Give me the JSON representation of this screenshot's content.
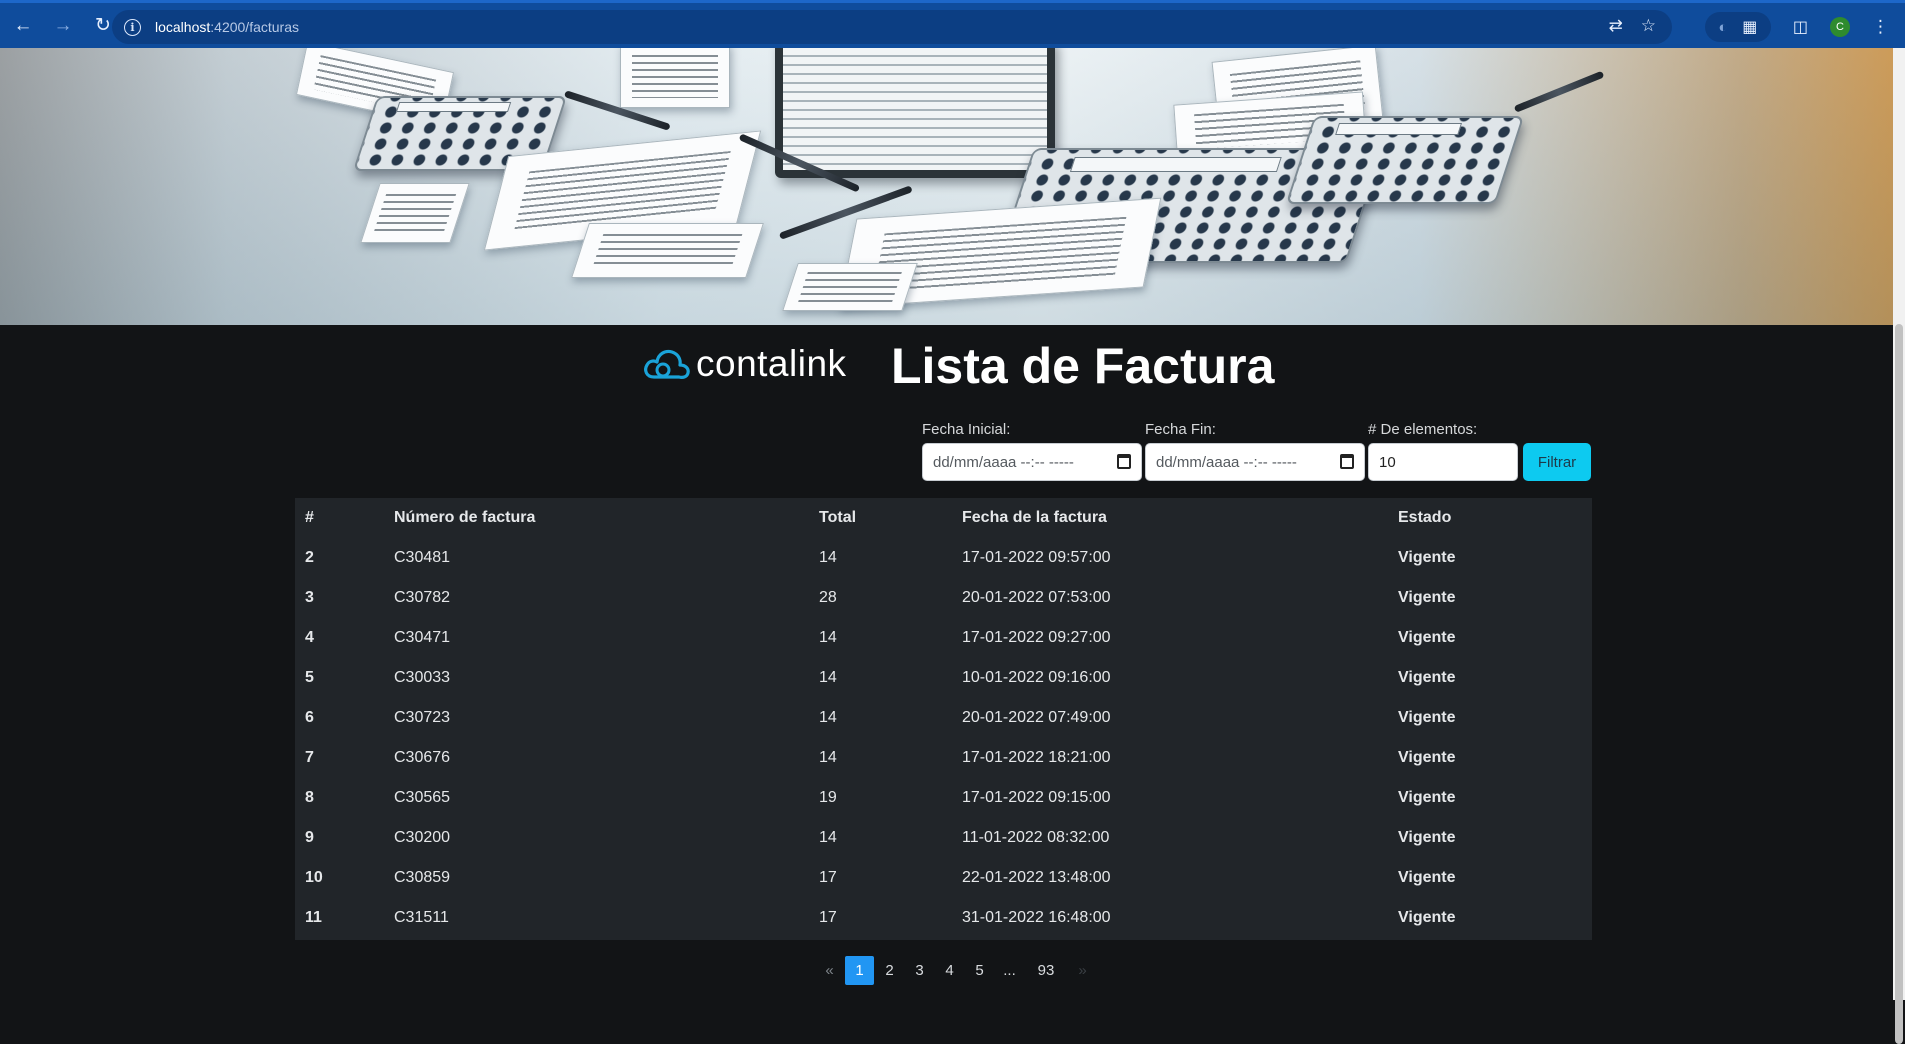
{
  "browser": {
    "url_host": "localhost",
    "url_path": ":4200/facturas",
    "avatar_letter": "C"
  },
  "brand": {
    "logo_text": "contalink",
    "accent": "#1aa3d9"
  },
  "page": {
    "title": "Lista de Factura"
  },
  "filters": {
    "start_label": "Fecha Inicial:",
    "start_placeholder": "dd/mm/aaaa --:-- -----",
    "end_label": "Fecha Fin:",
    "end_placeholder": "dd/mm/aaaa --:-- -----",
    "count_label": "# De elementos:",
    "count_value": "10",
    "button_label": "Filtrar",
    "button_color": "#0dcaf0"
  },
  "table": {
    "headers": [
      "#",
      "Número de factura",
      "Total",
      "Fecha de la factura",
      "Estado"
    ],
    "rows": [
      [
        "2",
        "C30481",
        "14",
        "17-01-2022 09:57:00",
        "Vigente"
      ],
      [
        "3",
        "C30782",
        "28",
        "20-01-2022 07:53:00",
        "Vigente"
      ],
      [
        "4",
        "C30471",
        "14",
        "17-01-2022 09:27:00",
        "Vigente"
      ],
      [
        "5",
        "C30033",
        "14",
        "10-01-2022 09:16:00",
        "Vigente"
      ],
      [
        "6",
        "C30723",
        "14",
        "20-01-2022 07:49:00",
        "Vigente"
      ],
      [
        "7",
        "C30676",
        "14",
        "17-01-2022 18:21:00",
        "Vigente"
      ],
      [
        "8",
        "C30565",
        "19",
        "17-01-2022 09:15:00",
        "Vigente"
      ],
      [
        "9",
        "C30200",
        "14",
        "11-01-2022 08:32:00",
        "Vigente"
      ],
      [
        "10",
        "C30859",
        "17",
        "22-01-2022 13:48:00",
        "Vigente"
      ],
      [
        "11",
        "C31511",
        "17",
        "31-01-2022 16:48:00",
        "Vigente"
      ]
    ]
  },
  "pagination": {
    "prev": "«",
    "pages": [
      "1",
      "2",
      "3",
      "4",
      "5",
      "...",
      "93"
    ],
    "next": "»",
    "active_page": "1",
    "active_color": "#2196f3"
  }
}
